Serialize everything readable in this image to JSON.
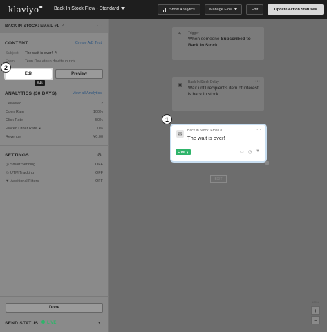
{
  "topbar": {
    "logo": "klaviyo",
    "flow_title": "Back In Stock Flow - Standard",
    "show_analytics": "Show Analytics",
    "manage_flow": "Manage Flow",
    "edit": "Edit",
    "update_action_statuses": "Update Action Statuses"
  },
  "left_panel": {
    "email_title": "BACK IN STOCK: EMAIL #1",
    "content": {
      "heading": "CONTENT",
      "ab_link": "Create A/B Test",
      "subject_label": "Subject:",
      "subject_value": "The wait is over!",
      "from_label": "From:",
      "from_value": "Teun Dev <teun.devittsun.ric>",
      "edit_button": "Edit",
      "preview_button": "Preview",
      "edit_tooltip": "Edit"
    },
    "analytics": {
      "heading": "ANALYTICS (30 DAYS)",
      "link": "View all Analytics",
      "rows": [
        {
          "label": "Delivered",
          "value": "2"
        },
        {
          "label": "Open Rate",
          "value": "100%"
        },
        {
          "label": "Click Rate",
          "value": "50%"
        },
        {
          "label": "Placed Order Rate",
          "value": "0%"
        },
        {
          "label": "Revenue",
          "value": "¥0.00"
        }
      ]
    },
    "settings": {
      "heading": "SETTINGS",
      "rows": [
        {
          "label": "Smart Sending",
          "value": "OFF"
        },
        {
          "label": "UTM Tracking",
          "value": "OFF"
        },
        {
          "label": "Additional Filters",
          "value": "OFF"
        }
      ]
    },
    "done_button": "Done",
    "send_status": {
      "label": "SEND STATUS",
      "value": "LIVE"
    }
  },
  "canvas": {
    "trigger": {
      "label": "Trigger",
      "text_prefix": "When someone ",
      "text_bold": "Subscribed to Back in Stock"
    },
    "delay": {
      "label": "Back In Stock Delay",
      "text": "Wait until recipient's item of interest is back in stock."
    },
    "email": {
      "label": "Back In Stock: Email #1",
      "text": "The wait is over!",
      "status": "Live"
    },
    "exit": "EXIT",
    "zoom_label": "100%"
  },
  "annotations": {
    "one": "1",
    "two": "2"
  },
  "colors": {
    "live_green": "#2fb46a",
    "accent_blue": "#2f5680"
  }
}
